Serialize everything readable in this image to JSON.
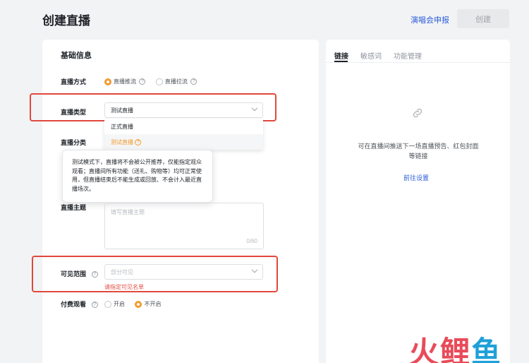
{
  "header": {
    "title": "创建直播",
    "concert_link": "演唱会申报",
    "create_label": "创建"
  },
  "form": {
    "section_title": "基础信息",
    "live_mode": {
      "label": "直播方式",
      "options": [
        "直播推流",
        "直播拉流"
      ],
      "selected": "直播推流"
    },
    "live_type": {
      "label": "直播类型",
      "value": "测试直播",
      "options": [
        "正式直播",
        "测试直播"
      ]
    },
    "live_category": {
      "label": "直播分类"
    },
    "tooltip_text": "测试模式下，直播将不会被公开推荐，仅能指定观众观看；直播间所有功能（送礼、购物等）均可正常使用，但直播结束后不能生成或回放、不会计入最近直播场次。",
    "live_topic": {
      "label": "直播主题",
      "placeholder": "填写直播主题",
      "counter": "0/60"
    },
    "visibility": {
      "label": "可见范围",
      "placeholder": "部分可见",
      "error": "请指定可见名单"
    },
    "paid": {
      "label": "付费观看",
      "options": [
        "开启",
        "不开启"
      ],
      "selected": "不开启"
    }
  },
  "right_panel": {
    "tabs": [
      "链接",
      "敏感词",
      "功能管理"
    ],
    "active_tab": "链接",
    "empty_text": "可在直播间推送下一场直播预告、红包封面等链接",
    "goto_link": "前往设置",
    "link_icon": "link-icon"
  },
  "watermark": {
    "chars": [
      "火",
      "鲤",
      "鱼"
    ],
    "colors": [
      "#e94b5a",
      "#e94b5a",
      "#1fa0d8"
    ]
  },
  "colors": {
    "accent": "#f29a2e",
    "link": "#2a5bd7",
    "error": "#e34d41"
  }
}
